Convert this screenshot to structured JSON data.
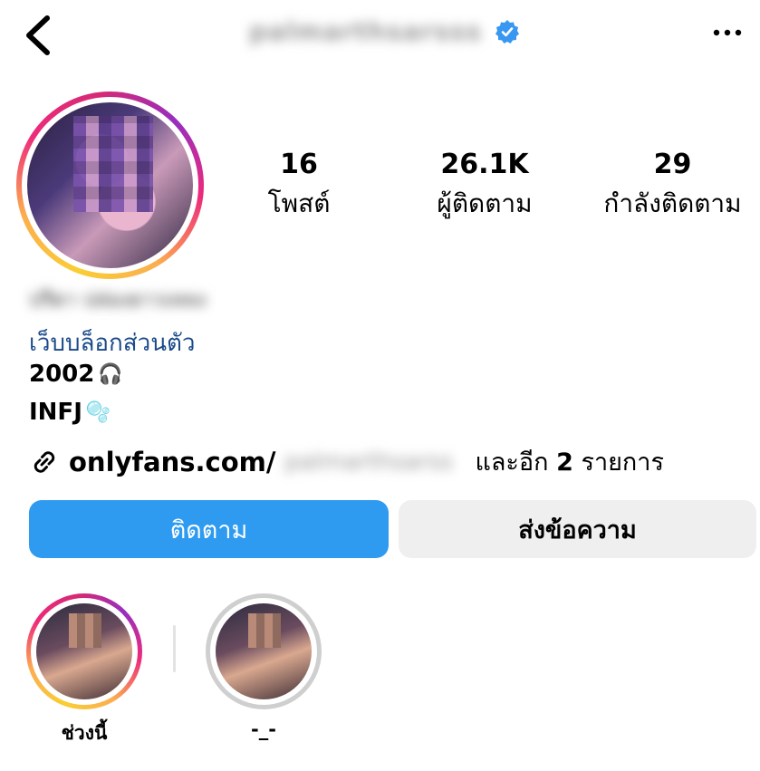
{
  "header": {
    "username": "palmarthsarsss",
    "verified_icon": "verified-badge-icon",
    "back_icon": "chevron-left-icon",
    "more_icon": "more-horizontal-icon"
  },
  "stats": {
    "posts_count": "16",
    "posts_label": "โพสต์",
    "followers_count": "26.1K",
    "followers_label": "ผู้ติดตาม",
    "following_count": "29",
    "following_label": "กำลังติดตาม"
  },
  "bio": {
    "display_name": "ปรีดา ปล่องยาวเหลง",
    "category": "เว็บบล็อกส่วนตัว",
    "line1": "2002",
    "line1_emoji": "🎧",
    "line2": "INFJ",
    "line2_emoji": "🫧"
  },
  "link": {
    "icon": "link-icon",
    "domain": "onlyfans.com/",
    "path": "palmarthsarss",
    "more_text": "และอีก",
    "more_count": "2",
    "more_unit": "รายการ"
  },
  "actions": {
    "follow_label": "ติดตาม",
    "message_label": "ส่งข้อความ"
  },
  "highlights": [
    {
      "label": "ช่วงนี้"
    },
    {
      "label": "-_-"
    }
  ],
  "colors": {
    "follow_button": "#2e9bf0",
    "message_button": "#efefef",
    "category_text": "#1a4a8a",
    "verified_blue": "#3897f0"
  }
}
